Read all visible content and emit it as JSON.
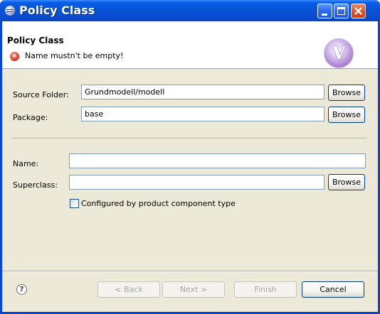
{
  "window": {
    "title": "Policy Class"
  },
  "header": {
    "title": "Policy Class",
    "error_message": "Name mustn't be empty!",
    "logo_letter": "V"
  },
  "form": {
    "source_folder_label": "Source Folder:",
    "source_folder_value": "Grundmodell/modell",
    "package_label": "Package:",
    "package_value": "base",
    "name_label": "Name:",
    "name_value": "",
    "superclass_label": "Superclass:",
    "superclass_value": "",
    "browse_label": "Browse",
    "checkbox_label": "Configured by product component type",
    "checkbox_checked": false
  },
  "footer": {
    "back_label": "< Back",
    "next_label": "Next >",
    "finish_label": "Finish",
    "cancel_label": "Cancel"
  },
  "icons": {
    "title": "eclipse-icon",
    "error": "error-icon",
    "help": "help-icon",
    "logo": "wizard-logo"
  }
}
